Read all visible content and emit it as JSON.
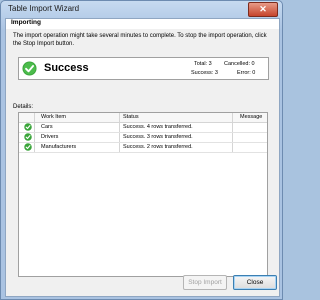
{
  "window": {
    "title": "Table Import Wizard",
    "close_glyph": "✕"
  },
  "header": {
    "title": "Importing"
  },
  "description": "The import operation might take several minutes to complete. To stop the import operation, click the Stop Import button.",
  "status": {
    "text": "Success",
    "icon": "success-check-icon",
    "total_label": "Total: 3",
    "cancelled_label": "Cancelled: 0",
    "success_label": "Success: 3",
    "error_label": "Error: 0"
  },
  "details": {
    "label": "Details:",
    "columns": [
      "Work Item",
      "Status",
      "Message"
    ],
    "rows": [
      {
        "work_item": "Cars",
        "status": "Success. 4 rows transferred.",
        "message": ""
      },
      {
        "work_item": "Drivers",
        "status": "Success. 3 rows transferred.",
        "message": ""
      },
      {
        "work_item": "Manufacturers",
        "status": "Success. 2 rows transferred.",
        "message": ""
      }
    ]
  },
  "buttons": {
    "stop_import": "Stop Import",
    "close": "Close"
  },
  "colors": {
    "success_green": "#3aa53a",
    "title_bar": "#b5cce8"
  }
}
